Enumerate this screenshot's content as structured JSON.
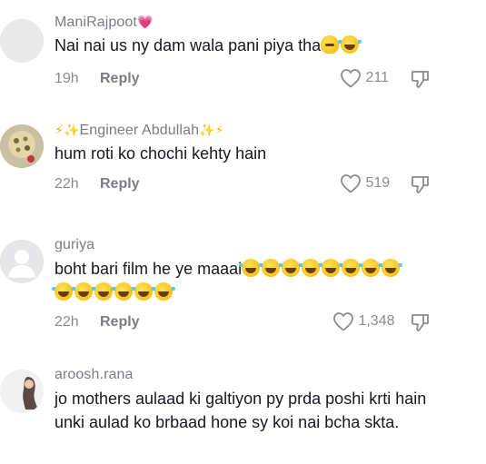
{
  "comments": [
    {
      "username": "ManiRajpoot",
      "text": "Nai nai us ny dam wala pani piya tha",
      "time": "19h",
      "reply": "Reply",
      "likes": "211"
    },
    {
      "username": "Engineer Abdullah",
      "text": "hum roti ko chochi kehty hain",
      "time": "22h",
      "reply": "Reply",
      "likes": "519"
    },
    {
      "username": "guriya",
      "text": "boht bari film he ye maaai",
      "time": "22h",
      "reply": "Reply",
      "likes": "1,348"
    },
    {
      "username": "aroosh.rana",
      "text": "jo mothers aulaad ki galtiyon py prda poshi krti hain unki aulad ko brbaad hone sy koi nai bcha skta."
    }
  ],
  "icons": {
    "like": "heart-outline-icon",
    "dislike": "thumbs-down-outline-icon"
  },
  "colors": {
    "text": "#161823",
    "secondary": "#7c7d83",
    "meta": "#8a8b91"
  }
}
